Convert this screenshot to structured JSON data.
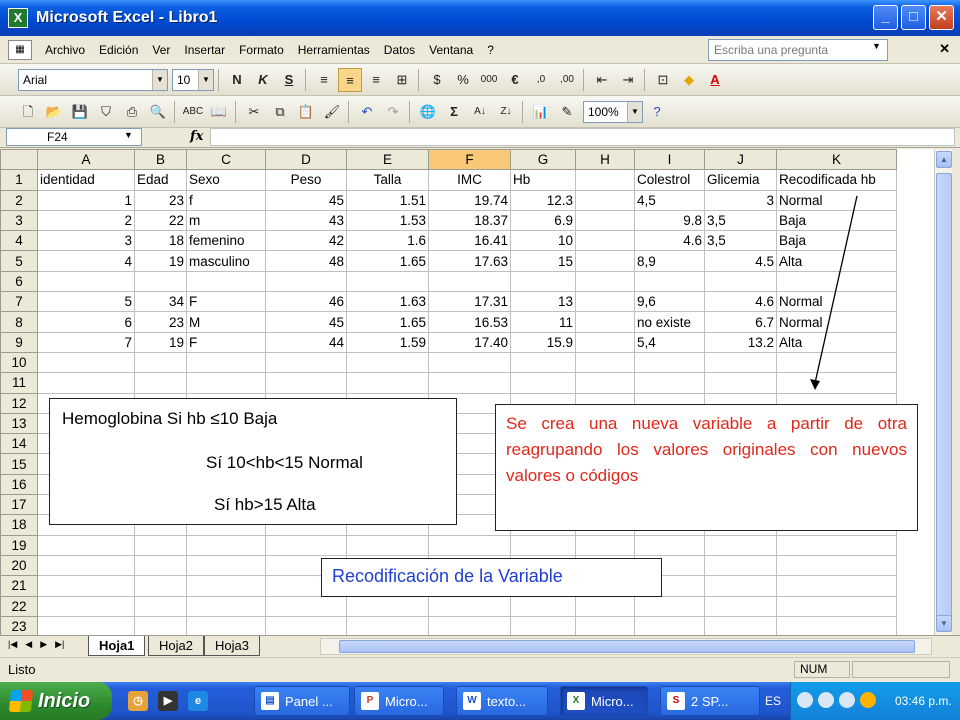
{
  "window": {
    "title": "Microsoft Excel - Libro1",
    "app_icon": "excel-icon",
    "buttons": [
      "minimize",
      "maximize",
      "close"
    ]
  },
  "menubar": {
    "items": [
      "Archivo",
      "Edición",
      "Ver",
      "Insertar",
      "Formato",
      "Herramientas",
      "Datos",
      "Ventana",
      "?"
    ],
    "ask_placeholder": "Escriba una pregunta"
  },
  "format_toolbar": {
    "font": "Arial",
    "size": "10",
    "bold": "N",
    "italic": "K",
    "underline": "S"
  },
  "standard_toolbar": {
    "zoom": "100%"
  },
  "formula_bar": {
    "name_box": "F24",
    "fx": "fx",
    "formula": ""
  },
  "sheet": {
    "selected_column": "F",
    "columns": [
      "A",
      "B",
      "C",
      "D",
      "E",
      "F",
      "G",
      "H",
      "I",
      "J",
      "K"
    ],
    "rows": [
      [
        "identidad",
        "Edad",
        "Sexo",
        "Peso",
        "Talla",
        "IMC",
        "Hb",
        "",
        "Colestrol",
        "Glicemia",
        "Recodificada hb"
      ],
      [
        "1",
        "23",
        "f",
        "45",
        "1.51",
        "19.74",
        "12.3",
        "",
        "4,5",
        "3",
        "Normal"
      ],
      [
        "2",
        "22",
        "m",
        "43",
        "1.53",
        "18.37",
        "6.9",
        "",
        "9.8",
        "3,5",
        "Baja"
      ],
      [
        "3",
        "18",
        "femenino",
        "42",
        "1.6",
        "16.41",
        "10",
        "",
        "4.6",
        "3,5",
        "Baja"
      ],
      [
        "4",
        "19",
        "masculino",
        "48",
        "1.65",
        "17.63",
        "15",
        "",
        "8,9",
        "4.5",
        "Alta"
      ],
      [
        "",
        "",
        "",
        "",
        "",
        "",
        "",
        "",
        "",
        "",
        ""
      ],
      [
        "5",
        "34",
        "F",
        "46",
        "1.63",
        "17.31",
        "13",
        "",
        "9,6",
        "4.6",
        "Normal"
      ],
      [
        "6",
        "23",
        "M",
        "45",
        "1.65",
        "16.53",
        "11",
        "",
        "no existe",
        "6.7",
        "Normal"
      ],
      [
        "7",
        "19",
        "F",
        "44",
        "1.59",
        "17.40",
        "15.9",
        "",
        "5,4",
        "13.2",
        "Alta"
      ],
      [
        "",
        "",
        "",
        "",
        "",
        "",
        "",
        "",
        "",
        "",
        ""
      ],
      [
        "",
        "",
        "",
        "",
        "",
        "",
        "",
        "",
        "",
        "",
        ""
      ],
      [
        "",
        "",
        "",
        "",
        "",
        "",
        "",
        "",
        "",
        "",
        ""
      ],
      [
        "",
        "",
        "",
        "",
        "",
        "",
        "",
        "",
        "",
        "",
        ""
      ],
      [
        "",
        "",
        "",
        "",
        "",
        "",
        "",
        "",
        "",
        "",
        ""
      ],
      [
        "",
        "",
        "",
        "",
        "",
        "",
        "",
        "",
        "",
        "",
        ""
      ],
      [
        "",
        "",
        "",
        "",
        "",
        "",
        "",
        "",
        "",
        "",
        ""
      ],
      [
        "",
        "",
        "",
        "",
        "",
        "",
        "",
        "",
        "",
        "",
        ""
      ],
      [
        "",
        "",
        "",
        "",
        "",
        "",
        "",
        "",
        "",
        "",
        ""
      ],
      [
        "",
        "",
        "",
        "",
        "",
        "",
        "",
        "",
        "",
        "",
        ""
      ],
      [
        "",
        "",
        "",
        "",
        "",
        "",
        "",
        "",
        "",
        "",
        ""
      ],
      [
        "",
        "",
        "",
        "",
        "",
        "",
        "",
        "",
        "",
        "",
        ""
      ],
      [
        "",
        "",
        "",
        "",
        "",
        "",
        "",
        "",
        "",
        "",
        ""
      ],
      [
        "",
        "",
        "",
        "",
        "",
        "",
        "",
        "",
        "",
        "",
        ""
      ]
    ]
  },
  "overlays": {
    "hemoglobina": {
      "line1": "Hemoglobina Si hb ≤10 Baja",
      "line2": "Sí 10<hb<15  Normal",
      "line3": "Sí hb>15 Alta"
    },
    "note": "Se crea una nueva variable a partir de otra reagrupando los valores originales con nuevos valores o códigos",
    "title": "Recodificación  de la Variable",
    "note_color": "#e0281b",
    "title_color": "#1f3fcf"
  },
  "tabs": {
    "sheets": [
      "Hoja1",
      "Hoja2",
      "Hoja3"
    ],
    "active": "Hoja1"
  },
  "status": {
    "text": "Listo",
    "num": "NUM"
  },
  "taskbar": {
    "start": "Inicio",
    "tasks": [
      "Panel ...",
      "Micro...",
      "texto...",
      "Micro...",
      "2 SP..."
    ],
    "lang": "ES",
    "clock": "03:46 p.m."
  }
}
